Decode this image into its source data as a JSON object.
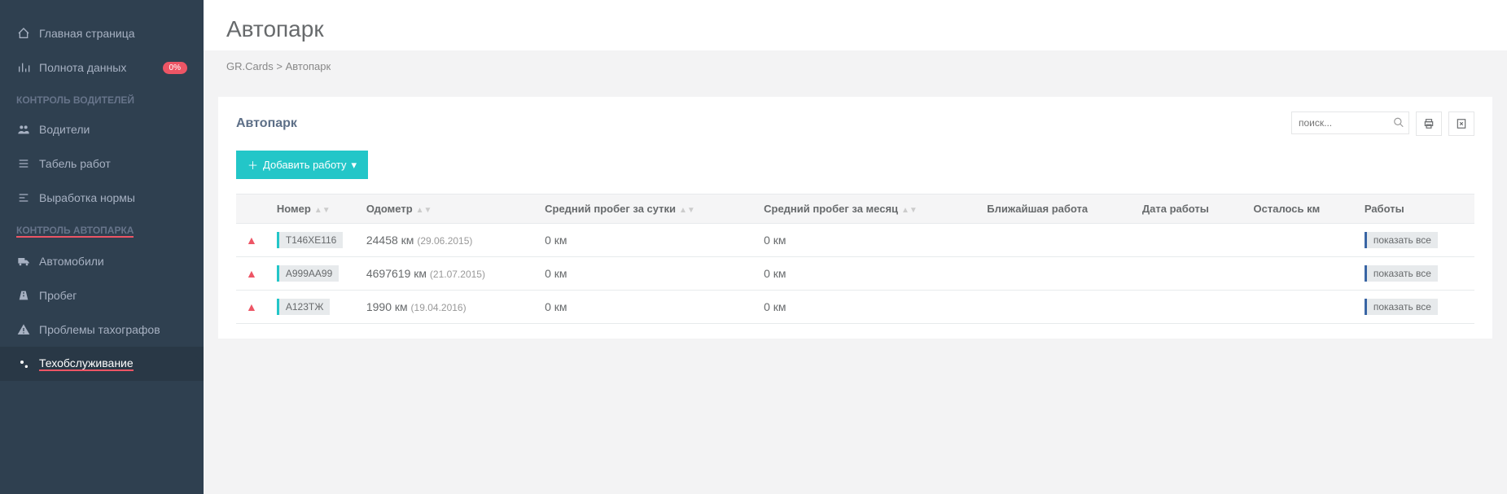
{
  "sidebar": {
    "home": "Главная страница",
    "data_completeness": "Полнота данных",
    "data_completeness_badge": "0%",
    "section_drivers": "КОНТРОЛЬ ВОДИТЕЛЕЙ",
    "drivers": "Водители",
    "timesheet": "Табель работ",
    "norms": "Выработка нормы",
    "section_fleet": "КОНТРОЛЬ АВТОПАРКА",
    "vehicles": "Автомобили",
    "mileage": "Пробег",
    "tacho_problems": "Проблемы тахографов",
    "maintenance": "Техобслуживание"
  },
  "page": {
    "title": "Автопарк",
    "breadcrumb_root": "GR.Cards",
    "breadcrumb_sep": " > ",
    "breadcrumb_current": "Автопарк"
  },
  "card": {
    "title": "Автопарк",
    "search_placeholder": "поиск...",
    "add_button": "Добавить работу"
  },
  "table": {
    "headers": {
      "number": "Номер",
      "odometer": "Одометр",
      "avg_day": "Средний пробег за сутки",
      "avg_month": "Средний пробег за месяц",
      "next_job": "Ближайшая работа",
      "job_date": "Дата работы",
      "km_left": "Осталось км",
      "jobs": "Работы"
    },
    "rows": [
      {
        "plate": "Т146ХЕ116",
        "odo": "24458 км",
        "odo_date": "(29.06.2015)",
        "avg_day": "0 км",
        "avg_month": "0 км",
        "next_job": "",
        "job_date": "",
        "km_left": "",
        "show_all": "показать все"
      },
      {
        "plate": "А999АА99",
        "odo": "4697619 км",
        "odo_date": "(21.07.2015)",
        "avg_day": "0 км",
        "avg_month": "0 км",
        "next_job": "",
        "job_date": "",
        "km_left": "",
        "show_all": "показать все"
      },
      {
        "plate": "А123ТЖ",
        "odo": "1990 км",
        "odo_date": "(19.04.2016)",
        "avg_day": "0 км",
        "avg_month": "0 км",
        "next_job": "",
        "job_date": "",
        "km_left": "",
        "show_all": "показать все"
      }
    ]
  }
}
